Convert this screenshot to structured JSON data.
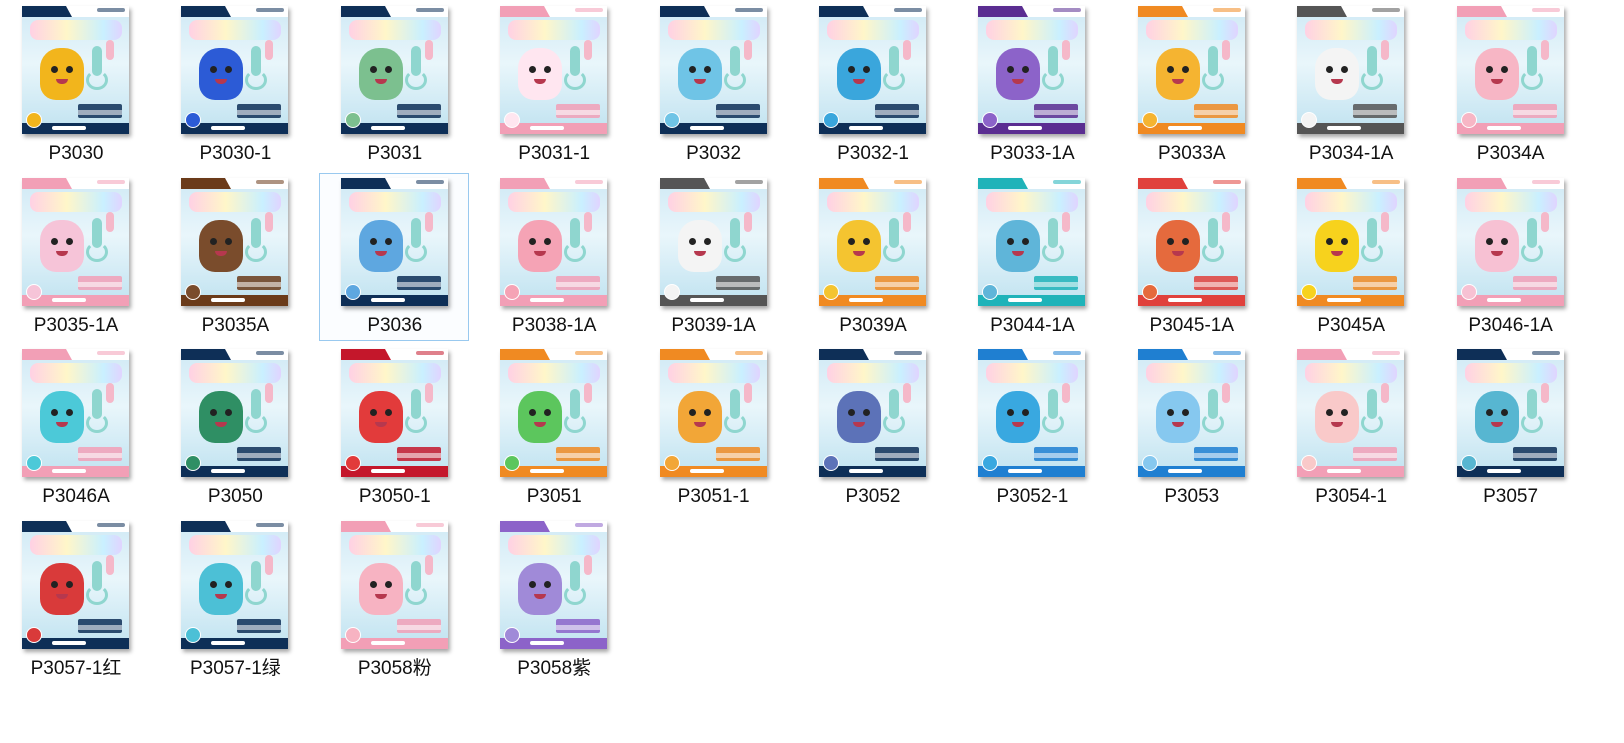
{
  "files": [
    {
      "label": "P3030",
      "accent": "#0e2f57",
      "tank": "#f2b51c"
    },
    {
      "label": "P3030-1",
      "accent": "#0e2f57",
      "tank": "#2c5bd6"
    },
    {
      "label": "P3031",
      "accent": "#0e2f57",
      "tank": "#7cc08f"
    },
    {
      "label": "P3031-1",
      "accent": "#f29fb6",
      "tank": "#ffe6f0"
    },
    {
      "label": "P3032",
      "accent": "#0e2f57",
      "tank": "#6fc4e6"
    },
    {
      "label": "P3032-1",
      "accent": "#0e2f57",
      "tank": "#3aa6dc"
    },
    {
      "label": "P3033-1A",
      "accent": "#5a2d91",
      "tank": "#8c63c9"
    },
    {
      "label": "P3033A",
      "accent": "#f08a22",
      "tank": "#f5b431"
    },
    {
      "label": "P3034-1A",
      "accent": "#555555",
      "tank": "#f4f4f4"
    },
    {
      "label": "P3034A",
      "accent": "#f29fb6",
      "tank": "#f7b6c5"
    },
    {
      "label": "P3035-1A",
      "accent": "#f29fb6",
      "tank": "#f6c4d8"
    },
    {
      "label": "P3035A",
      "accent": "#6b3b1a",
      "tank": "#7a4c2c"
    },
    {
      "label": "P3036",
      "accent": "#0e2f57",
      "tank": "#5ea7e0"
    },
    {
      "label": "P3038-1A",
      "accent": "#f29fb6",
      "tank": "#f5a3b5"
    },
    {
      "label": "P3039-1A",
      "accent": "#555555",
      "tank": "#f4f4f4"
    },
    {
      "label": "P3039A",
      "accent": "#f08a22",
      "tank": "#f4c430"
    },
    {
      "label": "P3044-1A",
      "accent": "#1fb3b9",
      "tank": "#5fb5d9"
    },
    {
      "label": "P3045-1A",
      "accent": "#e0413c",
      "tank": "#e56a3d"
    },
    {
      "label": "P3045A",
      "accent": "#f08a22",
      "tank": "#f7d21d"
    },
    {
      "label": "P3046-1A",
      "accent": "#f29fb6",
      "tank": "#f7c1d3"
    },
    {
      "label": "P3046A",
      "accent": "#f29fb6",
      "tank": "#4cc9d8"
    },
    {
      "label": "P3050",
      "accent": "#0e2f57",
      "tank": "#2f8f64"
    },
    {
      "label": "P3050-1",
      "accent": "#c4172b",
      "tank": "#e23b3b"
    },
    {
      "label": "P3051",
      "accent": "#f08a22",
      "tank": "#5cc65d"
    },
    {
      "label": "P3051-1",
      "accent": "#f08a22",
      "tank": "#f2a637"
    },
    {
      "label": "P3052",
      "accent": "#0e2f57",
      "tank": "#5c72b8"
    },
    {
      "label": "P3052-1",
      "accent": "#1f7fd1",
      "tank": "#39a8e0"
    },
    {
      "label": "P3053",
      "accent": "#1f7fd1",
      "tank": "#86c8ef"
    },
    {
      "label": "P3054-1",
      "accent": "#f29fb6",
      "tank": "#f9c9c9"
    },
    {
      "label": "P3057",
      "accent": "#0e2f57",
      "tank": "#57b6d1"
    },
    {
      "label": "P3057-1红",
      "accent": "#0e2f57",
      "tank": "#d93a3a"
    },
    {
      "label": "P3057-1绿",
      "accent": "#0e2f57",
      "tank": "#4cc0d6"
    },
    {
      "label": "P3058粉",
      "accent": "#f29fb6",
      "tank": "#f7b3c2"
    },
    {
      "label": "P3058紫",
      "accent": "#8c63c9",
      "tank": "#a08ad8"
    }
  ],
  "selected": "P3036"
}
